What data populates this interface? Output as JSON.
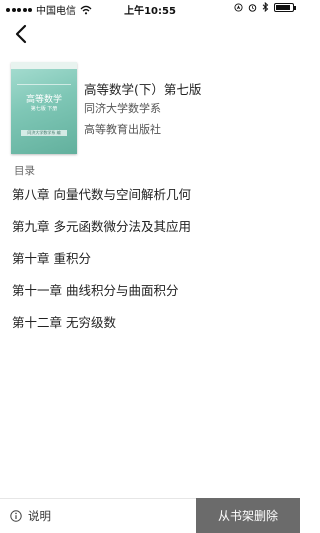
{
  "status_bar": {
    "carrier": "中国电信",
    "time": "上午10:55",
    "battery_percent": 90,
    "icons": [
      "signal-icon",
      "wifi-icon",
      "location-icon",
      "alarm-icon",
      "bluetooth-icon",
      "battery-icon"
    ]
  },
  "nav": {
    "back_icon": "chevron-left-icon"
  },
  "book": {
    "title": "高等数学(下）第七版",
    "author": "同济大学数学系",
    "publisher": "高等教育出版社",
    "cover": {
      "title": "高等数学",
      "subtitle": "第七版 下册",
      "author": "同济大学数学系 编"
    }
  },
  "toc": {
    "header": "目录",
    "items": [
      "第八章  向量代数与空间解析几何",
      "第九章  多元函数微分法及其应用",
      "第十章  重积分",
      "第十一章  曲线积分与曲面积分",
      "第十二章  无穷级数"
    ]
  },
  "bottom_bar": {
    "info_label": "说明",
    "remove_label": "从书架删除",
    "remove_color": "#6b6b6b"
  }
}
